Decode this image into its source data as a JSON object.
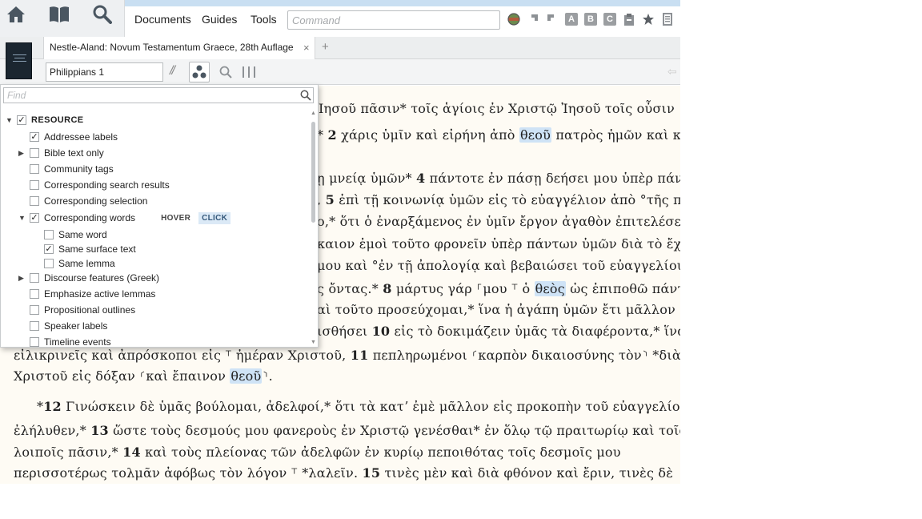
{
  "nav": {
    "menus": [
      "Documents",
      "Guides",
      "Tools"
    ],
    "command_placeholder": "Command",
    "toolbar_letters": [
      "A",
      "B",
      "C"
    ]
  },
  "tab": {
    "title": "Nestle-Aland: Novum Testamentum Graece, 28th Auflage",
    "close": "×",
    "add": "+"
  },
  "refbar": {
    "reference": "Philippians 1",
    "parallel_glyph": "//"
  },
  "panel": {
    "find_placeholder": "Find",
    "root": {
      "label": "RESOURCE",
      "checked": true
    },
    "items": [
      {
        "label": "Addressee labels",
        "checked": true,
        "expand": ""
      },
      {
        "label": "Bible text only",
        "checked": false,
        "expand": "▶"
      },
      {
        "label": "Community tags",
        "checked": false,
        "expand": ""
      },
      {
        "label": "Corresponding search results",
        "checked": false,
        "expand": ""
      },
      {
        "label": "Corresponding selection",
        "checked": false,
        "expand": ""
      },
      {
        "label": "Corresponding words",
        "checked": true,
        "expand": "▼",
        "hover": "HOVER",
        "click": "CLICK"
      },
      {
        "label": "Same word",
        "checked": false,
        "child": true
      },
      {
        "label": "Same surface text",
        "checked": true,
        "child": true
      },
      {
        "label": "Same lemma",
        "checked": false,
        "child": true
      },
      {
        "label": "Discourse features (Greek)",
        "checked": false,
        "expand": "▶"
      },
      {
        "label": "Emphasize active lemmas",
        "checked": false,
        "expand": ""
      },
      {
        "label": "Propositional outlines",
        "checked": false,
        "expand": ""
      },
      {
        "label": "Speaker labels",
        "checked": false,
        "expand": ""
      },
      {
        "label": "Timeline events",
        "checked": false,
        "expand": ""
      }
    ]
  },
  "text": {
    "l1": [
      "Ἰησοῦ πᾶσιν* τοῖς ἁγίοις ἐν Χριστῷ Ἰησοῦ τοῖς οὖσιν"
    ],
    "l2": [
      "* ",
      "2",
      " χάρις ὑμῖν καὶ εἰρήνη ἀπὸ ",
      "θεοῦ",
      " πατρὸς ἡμῶν καὶ κυρίου"
    ],
    "l3": [
      "ῃ μνείᾳ ὑμῶν* ",
      "4",
      " πάντοτε ἐν πάσῃ δεήσει μου ὑπὲρ πάντων"
    ],
    "l4": [
      ", ",
      "5",
      " ἐπὶ τῇ κοινωνίᾳ ὑμῶν εἰς τὸ εὐαγγέλιον ἀπὸ °τῆς πρώτης"
    ],
    "l5": [
      "ο,* ὅτι ὁ ἐναρξάμενος ἐν ὑμῖν ἔργον ἀγαθὸν ἐπιτελέσει"
    ],
    "l6": [
      "καιον ἐμοὶ τοῦτο φρονεῖν ὑπὲρ πάντων ὑμῶν διὰ τὸ ἔχειν"
    ],
    "l7": [
      " μου καὶ °ἐν τῇ ἀπολογίᾳ καὶ βεβαιώσει τοῦ εὐαγγελίου"
    ],
    "l8": [
      "ς ὄντας.* ",
      "8",
      " μάρτυς γάρ ⸀μου ⸆ ὁ ",
      "θεὸς",
      " ὡς ἐπιποθῶ πάντας"
    ],
    "l9": [
      "αὶ τοῦτο προσεύχομαι,* ἵνα ἡ ἀγάπη ὑμῶν ἔτι μᾶλλον"
    ],
    "l10": [
      "ισθήσει ",
      "10",
      " εἰς τὸ δοκιμάζειν ὑμᾶς τὰ διαφέροντα,* ἵνα ἦτε"
    ],
    "l11": [
      "εἰλικρινεῖς καὶ ἀπρόσκοποι εἰς ⸆ ἡμέραν Χριστοῦ, ",
      "11",
      " πεπληρωμένοι ⸂καρπὸν δικαιοσύνης τὸν⸃ *διὰ Ἰησοῦ"
    ],
    "l12": [
      "Χριστοῦ εἰς δόξαν ⸂καὶ ἔπαινον ",
      "θεοῦ",
      "⸃."
    ],
    "l13": [
      "*",
      "12",
      " Γινώσκειν δὲ ὑμᾶς βούλομαι, ἀδελφοί,* ὅτι τὰ κατʼ ἐμὲ μᾶλλον εἰς προκοπὴν τοῦ εὐαγγελίου"
    ],
    "l14": [
      "ἐλήλυθεν,* ",
      "13",
      " ὥστε τοὺς δεσμούς μου φανεροὺς ἐν Χριστῷ γενέσθαι* ἐν ὅλῳ τῷ πραιτωρίῳ καὶ τοῖς"
    ],
    "l15": [
      "λοιποῖς πᾶσιν,* ",
      "14",
      " καὶ τοὺς πλείονας τῶν ἀδελφῶν ἐν κυρίῳ πεποιθότας τοῖς δεσμοῖς μου"
    ],
    "l16": [
      "περισσοτέρως τολμᾶν ἀφόβως τὸν λόγον ⸆ *λαλεῖν. ",
      "15",
      " τινὲς μὲν καὶ διὰ φθόνον καὶ ἔριν, τινὲς δὲ"
    ]
  }
}
